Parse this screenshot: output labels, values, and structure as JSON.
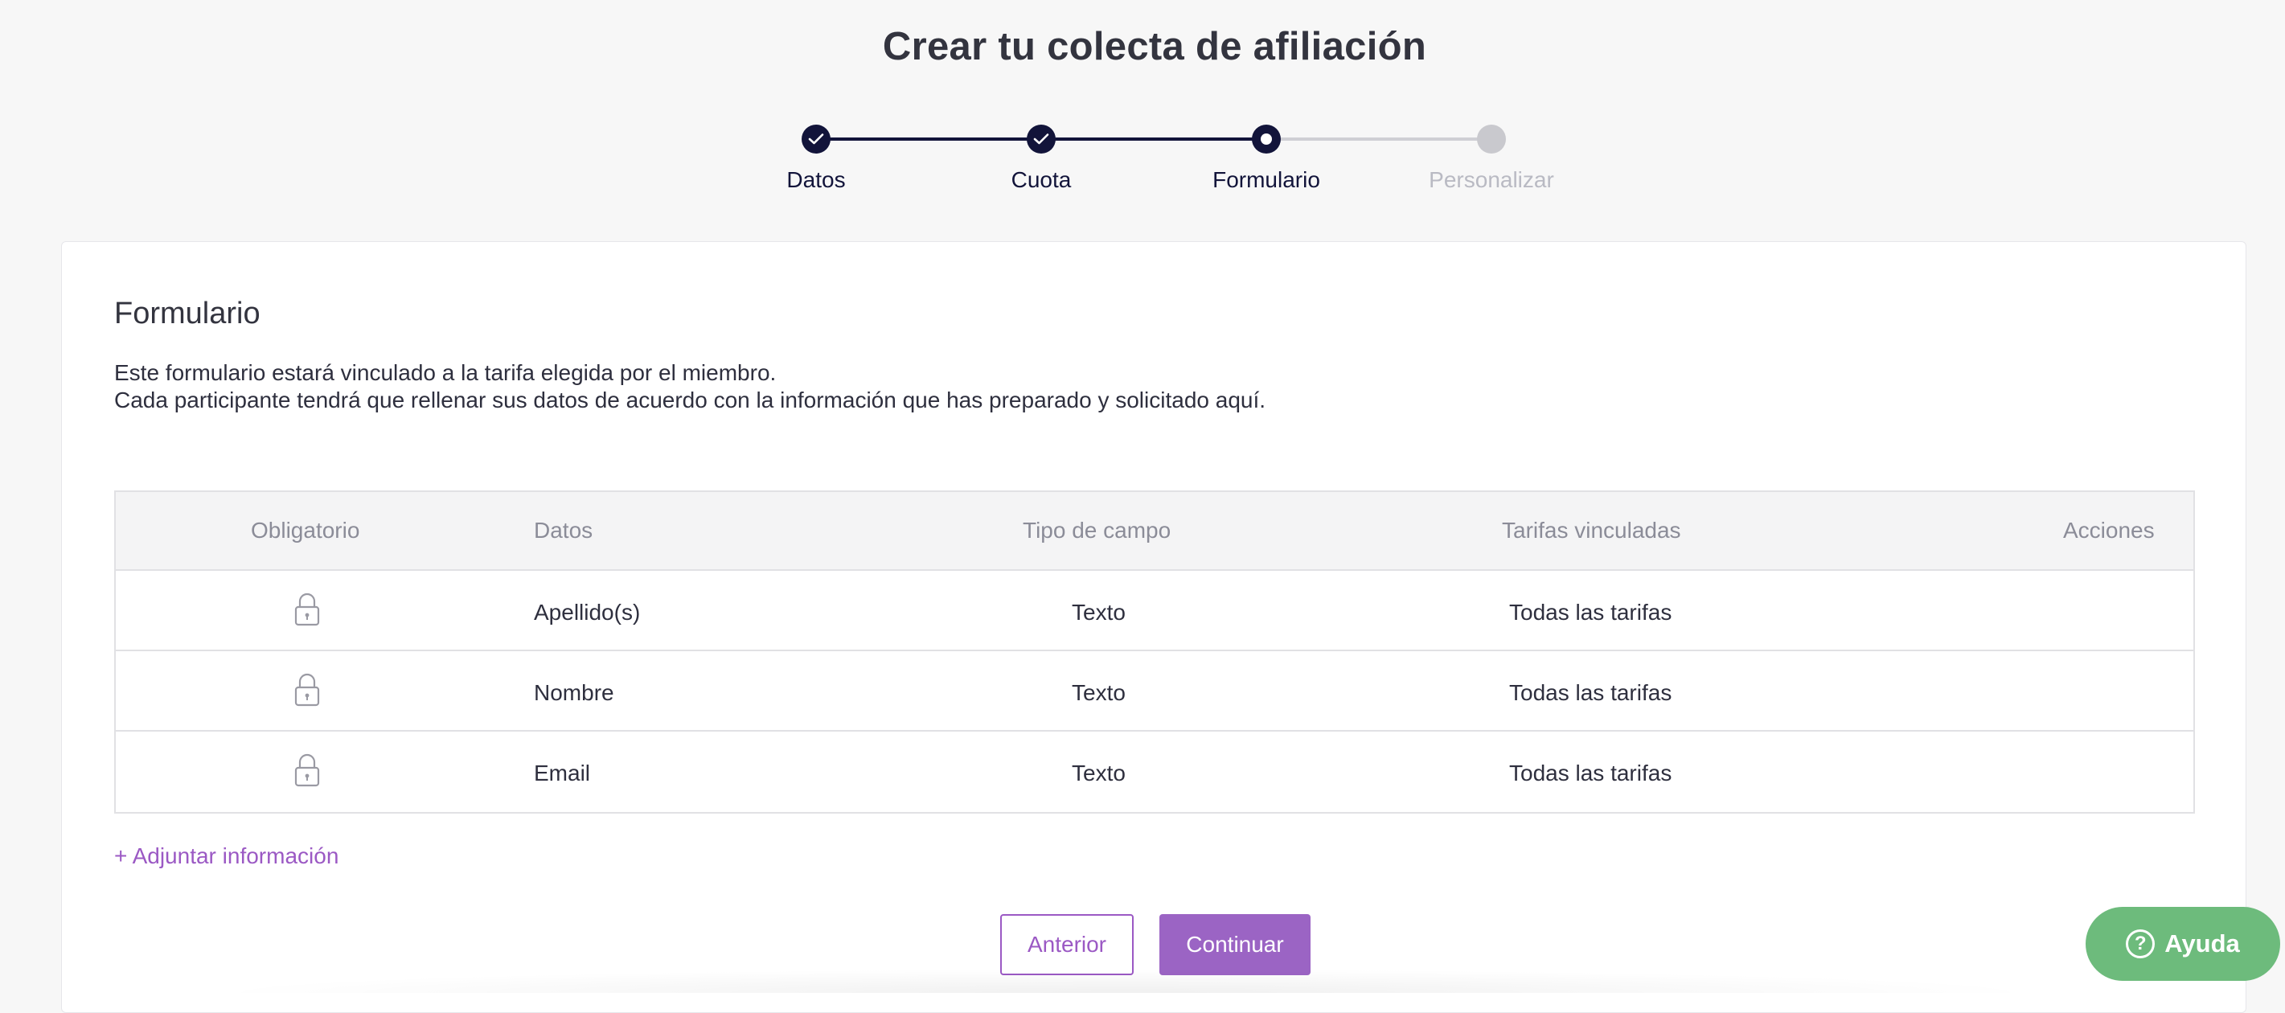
{
  "page": {
    "title": "Crear tu colecta de afiliación"
  },
  "stepper": {
    "steps": [
      {
        "label": "Datos",
        "state": "done"
      },
      {
        "label": "Cuota",
        "state": "done"
      },
      {
        "label": "Formulario",
        "state": "current"
      },
      {
        "label": "Personalizar",
        "state": "todo"
      }
    ]
  },
  "form": {
    "title": "Formulario",
    "description_line1": "Este formulario estará vinculado a la tarifa elegida por el miembro.",
    "description_line2": "Cada participante tendrá que rellenar sus datos de acuerdo con la información que has preparado y solicitado aquí.",
    "table": {
      "headers": [
        "Obligatorio",
        "Datos",
        "Tipo de campo",
        "Tarifas vinculadas",
        "Acciones"
      ],
      "rows": [
        {
          "required_icon": "lock-icon",
          "data": "Apellido(s)",
          "field_type": "Texto",
          "linked_rates": "Todas las tarifas"
        },
        {
          "required_icon": "lock-icon",
          "data": "Nombre",
          "field_type": "Texto",
          "linked_rates": "Todas las tarifas"
        },
        {
          "required_icon": "lock-icon",
          "data": "Email",
          "field_type": "Texto",
          "linked_rates": "Todas las tarifas"
        }
      ]
    },
    "add_link": "+ Adjuntar información",
    "prev_button": "Anterior",
    "next_button": "Continuar"
  },
  "help": {
    "label": "Ayuda",
    "icon": "question-icon"
  },
  "colors": {
    "accent": "#9b59c4",
    "navy": "#12143a",
    "help_green": "#6dbb7c"
  }
}
